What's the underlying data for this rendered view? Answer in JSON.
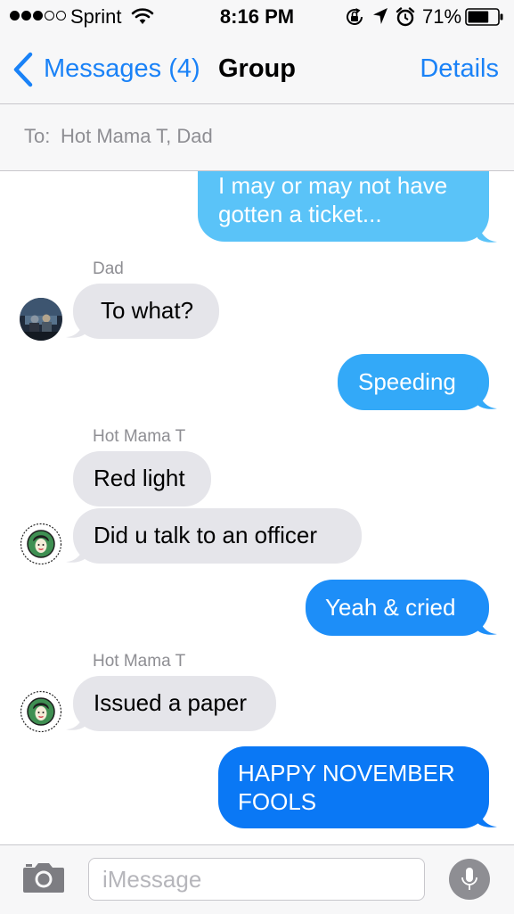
{
  "status_bar": {
    "carrier": "Sprint",
    "time": "8:16 PM",
    "battery_percent": "71%",
    "signal_bars_filled": 3,
    "signal_bars_total": 5,
    "battery_level": 0.71,
    "icons": [
      "wifi-icon",
      "rotation-lock-icon",
      "location-icon",
      "alarm-icon",
      "battery-icon"
    ]
  },
  "nav": {
    "back_label": "Messages (4)",
    "title": "Group",
    "details_label": "Details"
  },
  "recipients": {
    "label": "To:",
    "value": "Hot Mama T, Dad"
  },
  "conversation": {
    "sender_dad": "Dad",
    "sender_hot_mama_1": "Hot Mama T",
    "sender_hot_mama_2": "Hot Mama T",
    "messages": [
      {
        "direction": "sent",
        "line1": "I may or may not have",
        "line2": "gotten a ticket..."
      },
      {
        "direction": "received",
        "sender": "Dad",
        "text": "To what?"
      },
      {
        "direction": "sent",
        "text": "Speeding"
      },
      {
        "direction": "received",
        "sender": "Hot Mama T",
        "text": "Red light"
      },
      {
        "direction": "received",
        "sender": "Hot Mama T",
        "text": "Did u talk to an officer"
      },
      {
        "direction": "sent",
        "text": "Yeah & cried"
      },
      {
        "direction": "received",
        "sender": "Hot Mama T",
        "text": "Issued a paper"
      },
      {
        "direction": "sent",
        "line1": "HAPPY NOVEMBER",
        "line2": "FOOLS"
      }
    ]
  },
  "composer": {
    "placeholder": "iMessage",
    "camera_icon": "camera-icon",
    "mic_icon": "microphone-icon"
  },
  "colors": {
    "ios_blue": "#1a82f7",
    "received_bubble": "#e5e5ea",
    "sent_bubble_top": "#5ac3f8",
    "sent_bubble_bottom": "#0a78f5",
    "secondary_text": "#8e8e93",
    "bar_background": "#f7f7f8"
  }
}
